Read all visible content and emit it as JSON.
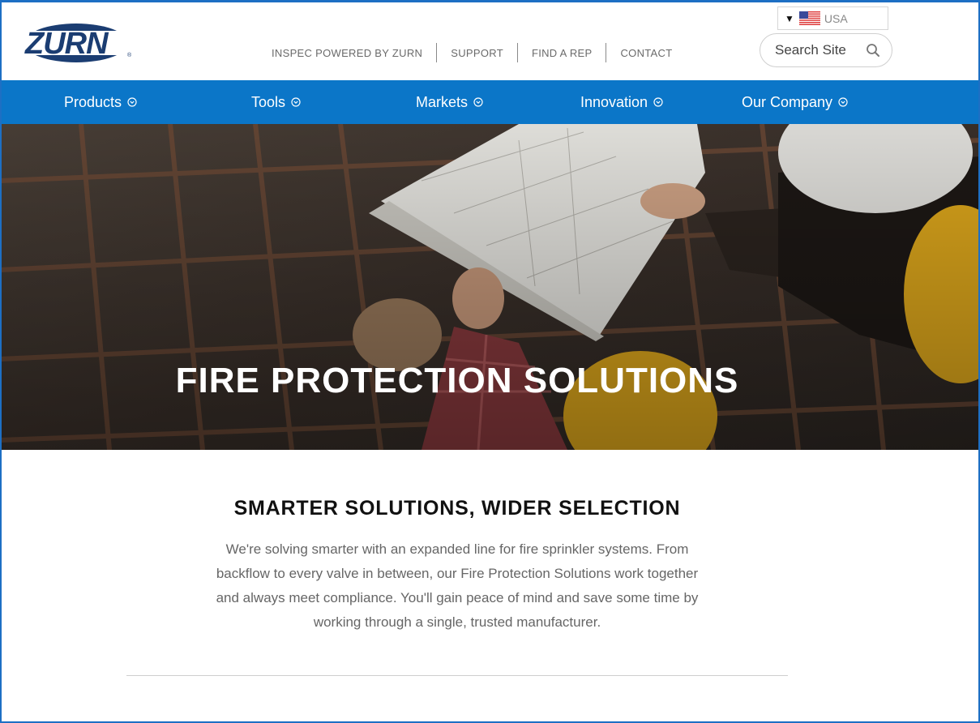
{
  "brand": {
    "logo_text": "ZURN",
    "primary_color": "#0b76c8",
    "logo_color": "#1b3d72"
  },
  "utility_nav": [
    {
      "label": "INSPEC POWERED BY ZURN"
    },
    {
      "label": "SUPPORT"
    },
    {
      "label": "FIND A REP"
    },
    {
      "label": "CONTACT"
    }
  ],
  "country_selector": {
    "label": "USA",
    "flag_icon": "us-flag-icon",
    "caret_icon": "caret-down-icon"
  },
  "search": {
    "placeholder": "Search Site",
    "icon": "search-icon"
  },
  "main_nav": [
    {
      "label": "Products",
      "icon": "circle-chevron-down-icon"
    },
    {
      "label": "Tools",
      "icon": "circle-chevron-down-icon"
    },
    {
      "label": "Markets",
      "icon": "circle-chevron-down-icon"
    },
    {
      "label": "Innovation",
      "icon": "circle-chevron-down-icon"
    },
    {
      "label": "Our Company",
      "icon": "circle-chevron-down-icon"
    }
  ],
  "hero": {
    "title": "FIRE PROTECTION SOLUTIONS"
  },
  "intro": {
    "headline": "SMARTER SOLUTIONS, WIDER SELECTION",
    "lines": [
      "We're solving smarter with an expanded line for fire sprinkler systems. From",
      "backflow to every valve in between, our Fire Protection Solutions work together",
      "and always meet compliance. You'll gain peace of mind and save some time by",
      "working through a single, trusted manufacturer."
    ]
  }
}
